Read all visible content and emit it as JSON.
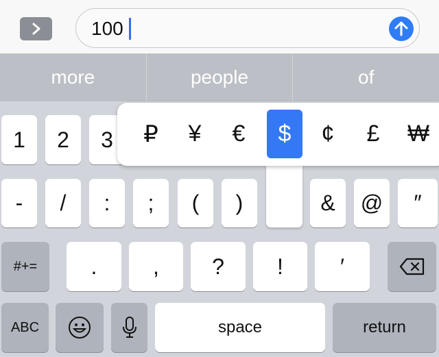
{
  "input": {
    "value": "100"
  },
  "suggestions": [
    "more",
    "people",
    "of"
  ],
  "currency_popup": {
    "options": [
      "₽",
      "¥",
      "€",
      "$",
      "¢",
      "£",
      "₩"
    ],
    "selected": "$",
    "accent": "#3478f6"
  },
  "rows": {
    "row1": [
      "1",
      "2",
      "3"
    ],
    "row2": [
      "-",
      "/",
      ":",
      ";",
      "(",
      ")",
      "&",
      "@",
      "″"
    ],
    "row3": {
      "toggle": "#+=",
      "keys": [
        ".",
        ",",
        "?",
        "!",
        "′"
      ]
    },
    "row4": {
      "abc": "ABC",
      "space": "space",
      "return": "return"
    }
  }
}
